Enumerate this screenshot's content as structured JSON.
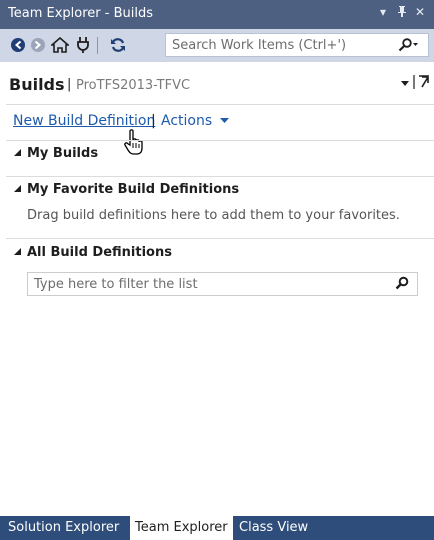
{
  "window": {
    "title": "Team Explorer - Builds",
    "icons": [
      "dropdown-arrow-icon",
      "pin-icon",
      "close-icon"
    ]
  },
  "toolbar": {
    "icons": [
      "back-icon",
      "forward-icon",
      "home-icon",
      "connect-icon",
      "refresh-icon"
    ],
    "search_placeholder": "Search Work Items (Ctrl+')"
  },
  "header": {
    "title": "Builds",
    "separator": "|",
    "subtitle": "ProTFS2013-TFVC"
  },
  "actions": {
    "new_build_definition": "New Build Definition",
    "separator": "|",
    "actions_label": "Actions"
  },
  "sections": {
    "my_builds": {
      "title": "My Builds"
    },
    "favorites": {
      "title": "My Favorite Build Definitions",
      "hint": "Drag build definitions here to add them to your favorites."
    },
    "all": {
      "title": "All Build Definitions",
      "filter_placeholder": "Type here to filter the list"
    }
  },
  "bottom_tabs": [
    {
      "label": "Solution Explorer",
      "active": false
    },
    {
      "label": "Team Explorer",
      "active": true
    },
    {
      "label": "Class View",
      "active": false
    }
  ],
  "colors": {
    "title_bar": "#4d6082",
    "toolbar": "#cfd6e5",
    "link": "#1e5bad",
    "bottom_bar": "#2f4d7a"
  }
}
